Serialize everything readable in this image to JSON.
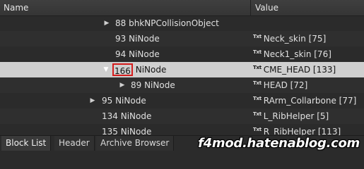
{
  "columns": {
    "name": "Name",
    "value": "Value"
  },
  "rows": [
    {
      "name": "88 bhkNPCollisionObject",
      "value": "",
      "type_icon": "",
      "expander": "collapsed"
    },
    {
      "name": "93 NiNode",
      "value": "Neck_skin [75]",
      "type_icon": "Txt",
      "expander": ""
    },
    {
      "name": "94 NiNode",
      "value": "Neck1_skin [76]",
      "type_icon": "Txt",
      "expander": ""
    },
    {
      "name_id": "166",
      "name_type": "NiNode",
      "value": "CME_HEAD [133]",
      "type_icon": "Txt",
      "expander": "expanded",
      "selected": true
    },
    {
      "name": "89 NiNode",
      "value": "HEAD [72]",
      "type_icon": "Txt",
      "expander": "collapsed"
    },
    {
      "name": "95 NiNode",
      "value": "RArm_Collarbone [77]",
      "type_icon": "Txt",
      "expander": "collapsed"
    },
    {
      "name": "134 NiNode",
      "value": "L_RibHelper [5]",
      "type_icon": "Txt",
      "expander": ""
    },
    {
      "name": "135 NiNode",
      "value": "R_RibHelper [113]",
      "type_icon": "Txt",
      "expander": ""
    }
  ],
  "tabs": [
    {
      "label": "Block List",
      "active": true
    },
    {
      "label": "Header",
      "active": false
    },
    {
      "label": "Archive Browser",
      "active": false
    }
  ],
  "watermark": "f4mod.hatenablog.com",
  "colors": {
    "background": "#2b2b2b",
    "selected_row": "#cfcfcf",
    "highlight_border": "#d41c1c"
  }
}
